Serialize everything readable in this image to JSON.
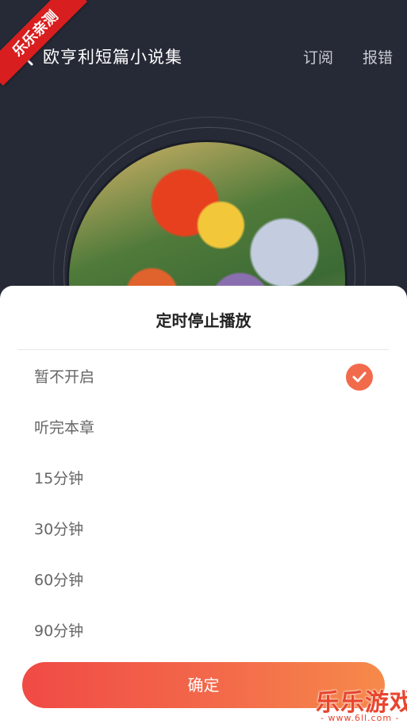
{
  "header": {
    "title": "欧亨利短篇小说集",
    "subscribe_label": "订阅",
    "report_label": "报错"
  },
  "watermark": {
    "ribbon_text": "乐乐亲测",
    "corner_main": "乐乐游戏",
    "corner_sub": "- www.6ll.com -"
  },
  "sheet": {
    "title": "定时停止播放",
    "options": [
      {
        "label": "暂不开启",
        "selected": true
      },
      {
        "label": "听完本章",
        "selected": false
      },
      {
        "label": "15分钟",
        "selected": false
      },
      {
        "label": "30分钟",
        "selected": false
      },
      {
        "label": "60分钟",
        "selected": false
      },
      {
        "label": "90分钟",
        "selected": false
      }
    ],
    "confirm_label": "确定"
  },
  "colors": {
    "background": "#262a36",
    "accent": "#f26a4c",
    "button_gradient_start": "#f04a45",
    "button_gradient_end": "#f68a4a"
  }
}
